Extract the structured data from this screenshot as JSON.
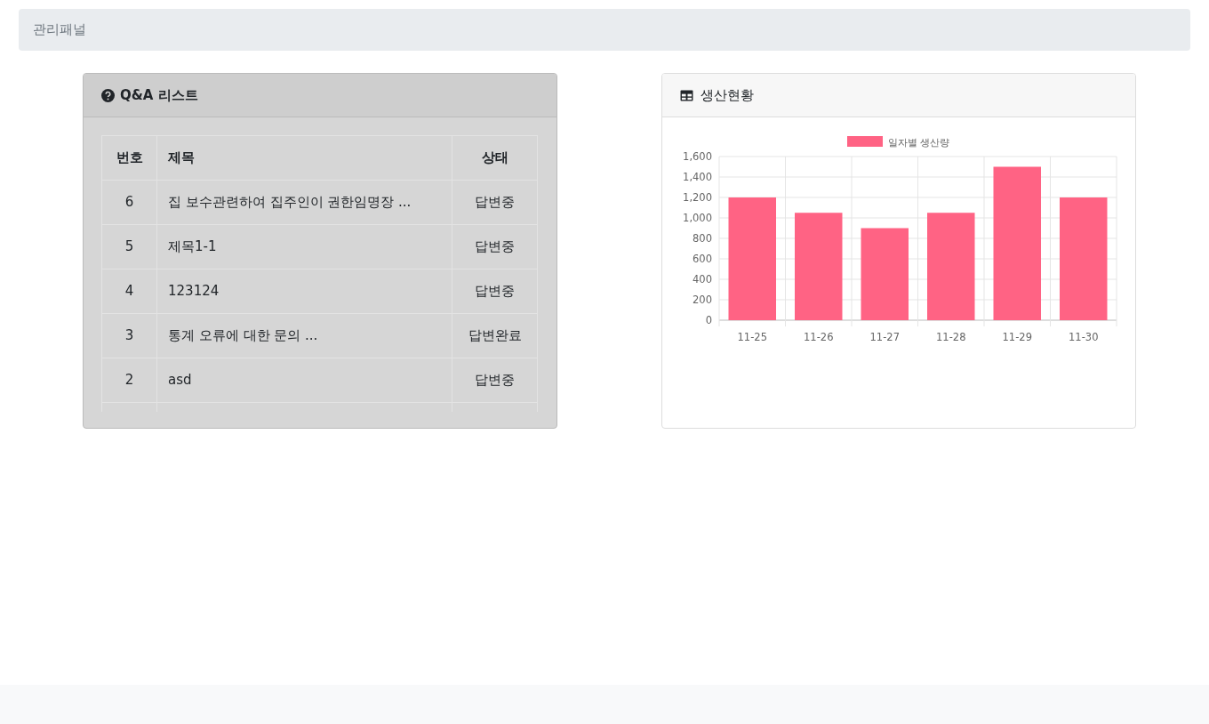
{
  "breadcrumb": "관리패널",
  "qna": {
    "title": "Q&A 리스트",
    "columns": [
      "번호",
      "제목",
      "상태"
    ],
    "rows": [
      {
        "no": "6",
        "title": "집 보수관련하여 집주인이 권한임명장 ...",
        "status": "답변중"
      },
      {
        "no": "5",
        "title": "제목1-1",
        "status": "답변중"
      },
      {
        "no": "4",
        "title": "123124",
        "status": "답변중"
      },
      {
        "no": "3",
        "title": "통계 오류에 대한 문의 ...",
        "status": "답변완료"
      },
      {
        "no": "2",
        "title": "asd",
        "status": "답변중"
      }
    ]
  },
  "production": {
    "title": "생산현황",
    "chart_data": {
      "type": "bar",
      "categories": [
        "11-25",
        "11-26",
        "11-27",
        "11-28",
        "11-29",
        "11-30"
      ],
      "series": [
        {
          "name": "일자별 생산량",
          "color": "#ff6384",
          "values": [
            1200,
            1050,
            900,
            1050,
            1500,
            1200
          ]
        }
      ],
      "ylim": [
        0,
        1600
      ],
      "grid": true,
      "yticks": [
        {
          "value": 0,
          "label": "0"
        },
        {
          "value": 200,
          "label": "200"
        },
        {
          "value": 400,
          "label": "400"
        },
        {
          "value": 600,
          "label": "600"
        },
        {
          "value": 800,
          "label": "800"
        },
        {
          "value": 1000,
          "label": "1,000"
        },
        {
          "value": 1200,
          "label": "1,200"
        },
        {
          "value": 1400,
          "label": "1,400"
        },
        {
          "value": 1600,
          "label": "1,600"
        }
      ]
    }
  }
}
